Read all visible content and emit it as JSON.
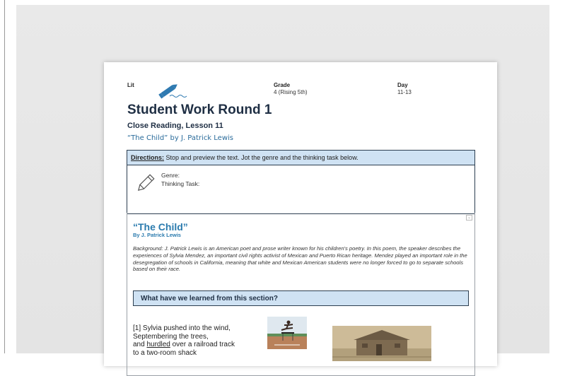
{
  "header": {
    "subject_label": "Lit",
    "grade_label": "Grade",
    "grade_value": "4 (Rising 5th)",
    "day_label": "Day",
    "day_value": "11-13"
  },
  "title": "Student Work Round 1",
  "subtitle": "Close Reading, Lesson 11",
  "work": "“The Child” by J. Patrick Lewis",
  "directions": {
    "label": "Directions:",
    "text": " Stop and preview the text. Jot the genre and the thinking task below.",
    "genre_label": "Genre:",
    "task_label": "Thinking Task:"
  },
  "poem": {
    "title": "“The Child”",
    "author": "By J. Patrick Lewis",
    "background": "Background: J. Patrick Lewis is an American poet and prose writer known for his children's poetry. In this poem, the speaker describes the experiences of Sylvia Mendez, an important civil rights activist of Mexican and Puerto Rican heritage. Mendez played an important role in the desegregation of schools in California, meaning that white and Mexican American students were no longer forced to go to separate schools based on their race.",
    "learned_heading": "What have we learned from this section?",
    "line1": "[1] Sylvia pushed into the wind,",
    "line2": "Septembering the trees,",
    "line3_pre": "and ",
    "line3_word": "hurdled",
    "line3_post": " over a railroad track",
    "line4": "to a two-room shack"
  },
  "icons": {
    "pen": "pen-icon",
    "pencil": "pencil-icon",
    "collapse": "collapse-icon"
  },
  "colors": {
    "accent_blue": "#2b7bae",
    "highlight_bar": "#cfe2f3",
    "title_navy": "#1f2f44"
  }
}
